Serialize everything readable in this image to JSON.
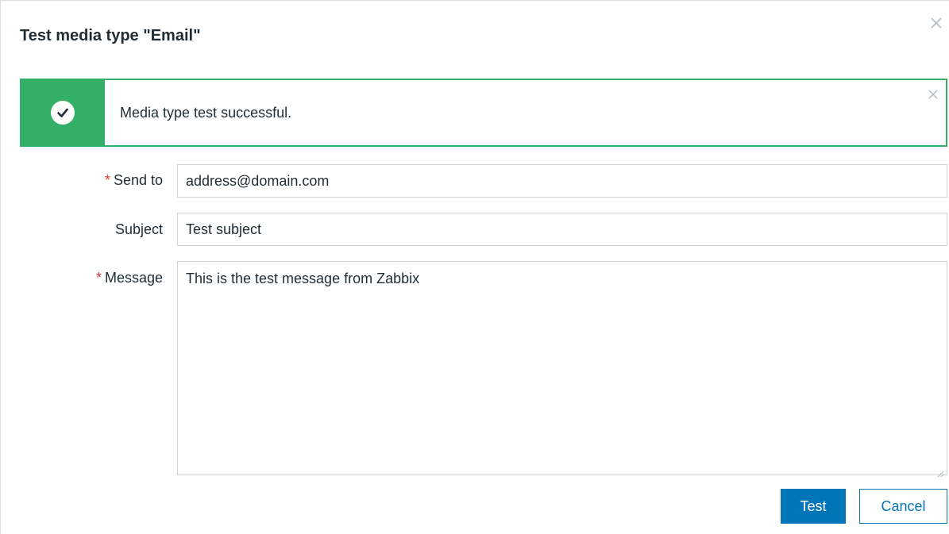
{
  "dialog": {
    "title": "Test media type \"Email\"",
    "close_icon": "close-icon"
  },
  "message": {
    "text": "Media type test successful.",
    "icon": "check-circle-icon",
    "close_icon": "close-icon",
    "color": "#34af67"
  },
  "form": {
    "required_marker": "*",
    "send_to": {
      "label": "Send to",
      "value": "address@domain.com",
      "required": true
    },
    "subject": {
      "label": "Subject",
      "value": "Test subject",
      "required": false
    },
    "message": {
      "label": "Message",
      "value": "This is the test message from Zabbix",
      "required": true
    }
  },
  "buttons": {
    "test_label": "Test",
    "cancel_label": "Cancel",
    "primary_color": "#0275b8"
  }
}
